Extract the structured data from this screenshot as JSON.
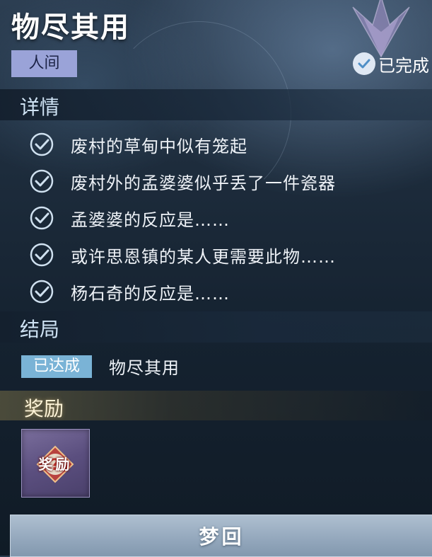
{
  "header": {
    "title": "物尽其用",
    "world_tag": "人间",
    "status": "已完成",
    "status_icon": "check-circle-icon"
  },
  "details": {
    "heading": "详情",
    "items": [
      {
        "text": "废村的草甸中似有笼起",
        "checked": true
      },
      {
        "text": "废村外的孟婆婆似乎丢了一件瓷器",
        "checked": true
      },
      {
        "text": "孟婆婆的反应是……",
        "checked": true
      },
      {
        "text": "或许思恩镇的某人更需要此物……",
        "checked": true
      },
      {
        "text": "杨石奇的反应是……",
        "checked": true
      }
    ]
  },
  "ending": {
    "heading": "结局",
    "badge": "已达成",
    "name": "物尽其用"
  },
  "rewards": {
    "heading": "奖励",
    "items": [
      {
        "label": "奖励",
        "icon": "mystery-reward-icon"
      }
    ]
  },
  "action": {
    "button_label": "梦回"
  },
  "colors": {
    "world_tag_bg": "#9aa3d8",
    "badge_bg": "#7ab3d6",
    "reward_bg": "#5b4f7f",
    "button_bg": "#93a7bc"
  }
}
